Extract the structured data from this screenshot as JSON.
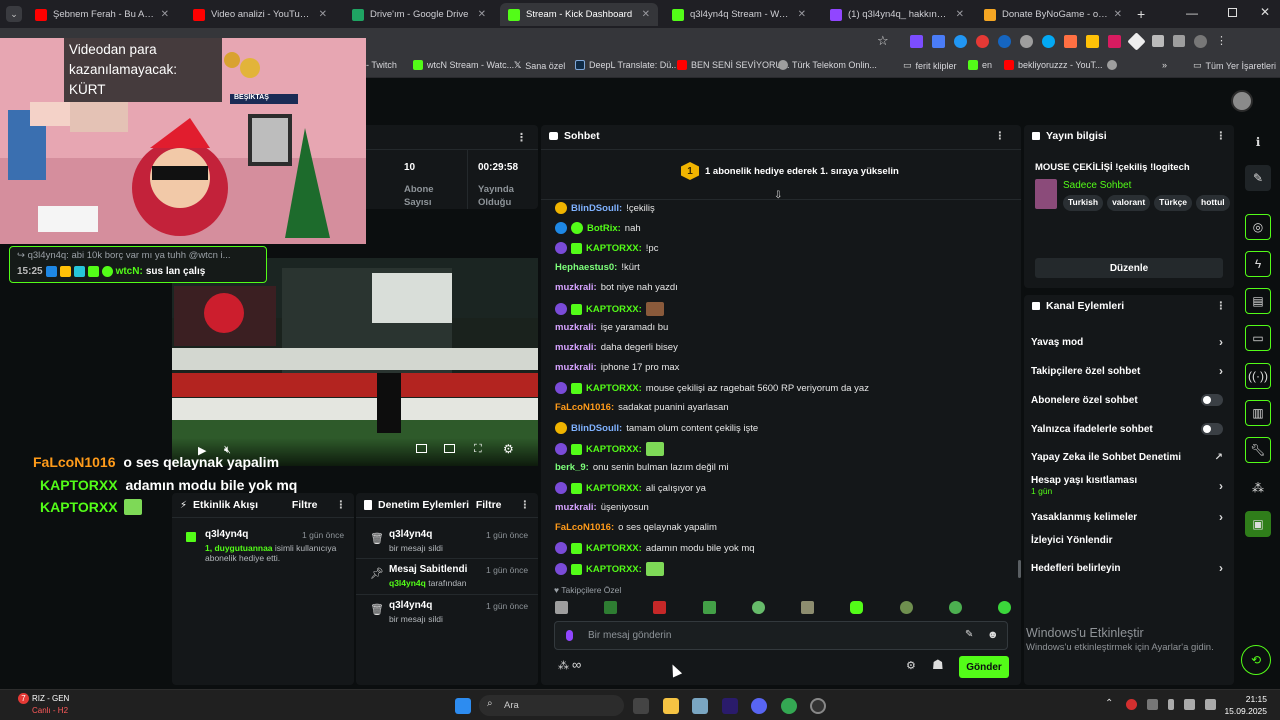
{
  "browser": {
    "tabs": [
      {
        "label": "Şebnem Ferah - Bu Aşk Fazla Sı",
        "color": "#ff0000"
      },
      {
        "label": "Video analizi - YouTube Studio",
        "color": "#ff0000"
      },
      {
        "label": "Drive'ım - Google Drive",
        "color": "#1fa463"
      },
      {
        "label": "Stream - Kick Dashboard",
        "color": "#53fc18"
      },
      {
        "label": "q3l4yn4q Stream - Watch Live o",
        "color": "#53fc18"
      },
      {
        "label": "(1) q3l4yn4q_ hakkında - Twitch",
        "color": "#9146ff"
      },
      {
        "label": "Donate ByNoGame - oyundiyc",
        "color": "#f5a623"
      }
    ],
    "bookmarks": [
      "- Twitch",
      "wtcN Stream - Watc...",
      "Sana özel",
      "DeepL Translate: Dü...",
      "BEN SENİ SEVİYORU...",
      "Türk Telekom Onlin...",
      "ferit klipler",
      "en",
      "bekliyoruzzz - YouT...",
      "Tüm Yer İşaretleri"
    ]
  },
  "overlay": {
    "warning_text": "Videodan para kazanılamayacak: KÜRT",
    "banner_text": "BEŞİKTAŞ",
    "pin_reply": "q3l4yn4q: abi 10k borç var mı ya tuhh @wtcn i...",
    "pin_time": "15:25",
    "pin_user": "wtcN:",
    "pin_text": "sus lan çalış",
    "bigchat": [
      {
        "user": "FaLcoN1016",
        "text": "o ses qelaynak yapalim",
        "color": "#ff9b1a"
      },
      {
        "user": "KAPTORXX",
        "text": "adamın modu bile yok mq",
        "color": "#53fc18"
      },
      {
        "user": "KAPTORXX",
        "text": "",
        "color": "#53fc18"
      }
    ]
  },
  "stats": {
    "count_value": "10",
    "count_label": "Abone Sayısı",
    "time_value": "00:29:58",
    "time_label": "Yayında Olduğu"
  },
  "activity": {
    "title": "Etkinlik Akışı",
    "filter": "Filtre",
    "item_user": "q3l4yn4q",
    "item_time": "1 gün önce",
    "item_highlight": "1, duygutuannaa",
    "item_text": "isimli kullanıcıya abonelik hediye etti."
  },
  "moderation": {
    "title": "Denetim Eylemleri",
    "filter": "Filtre",
    "items": [
      {
        "title": "q3l4yn4q",
        "sub": "bir mesajı sildi",
        "time": "1 gün önce",
        "hl": ""
      },
      {
        "title": "Mesaj Sabitlendi",
        "sub": "tarafından",
        "time": "1 gün önce",
        "hl": "q3l4yn4q"
      },
      {
        "title": "q3l4yn4q",
        "sub": "bir mesajı sildi",
        "time": "1 gün önce",
        "hl": ""
      }
    ]
  },
  "chat": {
    "title": "Sohbet",
    "promo": "1 abonelik hediye ederek 1. sıraya yükselin",
    "promo_number": "1",
    "messages": [
      {
        "user": "BlinDSoull:",
        "text": "!çekiliş",
        "color": "#7fb2ff",
        "badge": "#f0b400"
      },
      {
        "user": "BotRix:",
        "text": "nah",
        "color": "#53fc18",
        "badge": "#1e88e5"
      },
      {
        "user": "KAPTORXX:",
        "text": "!pc",
        "color": "#53fc18",
        "badge": "#7a4bd8"
      },
      {
        "user": "Hephaestus0:",
        "text": "!kürt",
        "color": "#7dff7a",
        "badge": ""
      },
      {
        "user": "muzkrali:",
        "text": "bot niye nah yazdı",
        "color": "#d6a3ff",
        "badge": ""
      },
      {
        "user": "KAPTORXX:",
        "text": "",
        "color": "#53fc18",
        "badge": "#7a4bd8"
      },
      {
        "user": "muzkrali:",
        "text": "işe yaramadı bu",
        "color": "#d6a3ff",
        "badge": ""
      },
      {
        "user": "muzkrali:",
        "text": "daha degerli bisey",
        "color": "#d6a3ff",
        "badge": ""
      },
      {
        "user": "muzkrali:",
        "text": "iphone 17 pro max",
        "color": "#d6a3ff",
        "badge": ""
      },
      {
        "user": "KAPTORXX:",
        "text": "mouse çekilişi az ragebait 5600 RP veriyorum da yaz",
        "color": "#53fc18",
        "badge": "#7a4bd8"
      },
      {
        "user": "FaLcoN1016:",
        "text": "sadakat puanini ayarlasan",
        "color": "#ff9b1a",
        "badge": ""
      },
      {
        "user": "BlinDSoull:",
        "text": "tamam olum content çekiliş işte",
        "color": "#7fb2ff",
        "badge": "#f0b400"
      },
      {
        "user": "KAPTORXX:",
        "text": "",
        "color": "#53fc18",
        "badge": "#7a4bd8"
      },
      {
        "user": "berk_9:",
        "text": "onu senin bulman lazım değil mi",
        "color": "#7dff7a",
        "badge": ""
      },
      {
        "user": "KAPTORXX:",
        "text": "ali çalışıyor ya",
        "color": "#53fc18",
        "badge": "#7a4bd8"
      },
      {
        "user": "muzkrali:",
        "text": "üşeniyosun",
        "color": "#d6a3ff",
        "badge": ""
      },
      {
        "user": "FaLcoN1016:",
        "text": "o ses qelaynak yapalim",
        "color": "#ff9b1a",
        "badge": ""
      },
      {
        "user": "KAPTORXX:",
        "text": "adamın modu bile yok mq",
        "color": "#53fc18",
        "badge": "#7a4bd8"
      },
      {
        "user": "KAPTORXX:",
        "text": "",
        "color": "#53fc18",
        "badge": "#7a4bd8"
      }
    ],
    "followers_only": "Takipçilere Özel",
    "input_placeholder": "Bir mesaj gönderin",
    "send_label": "Gönder"
  },
  "stream_info": {
    "title": "Yayın bilgisi",
    "stream_title": "MOUSE ÇEKİLİŞİ !çekiliş !logitech",
    "category": "Sadece Sohbet",
    "tags": [
      "Turkish",
      "valorant",
      "Türkçe",
      "hottul"
    ],
    "edit_label": "Düzenle"
  },
  "channel_actions": {
    "title": "Kanal Eylemleri",
    "rows": [
      {
        "label": "Yavaş mod",
        "kind": "chev",
        "sub": ""
      },
      {
        "label": "Takipçilere özel sohbet",
        "kind": "chev",
        "sub": ""
      },
      {
        "label": "Abonelere özel sohbet",
        "kind": "toggle",
        "sub": ""
      },
      {
        "label": "Yalnızca ifadelerle sohbet",
        "kind": "toggle",
        "sub": ""
      },
      {
        "label": "Yapay Zeka ile Sohbet Denetimi",
        "kind": "ext",
        "sub": ""
      },
      {
        "label": "Hesap yaşı kısıtlaması",
        "kind": "chev",
        "sub": "1 gün"
      },
      {
        "label": "Yasaklanmış kelimeler",
        "kind": "chev",
        "sub": ""
      },
      {
        "label": "İzleyici Yönlendir",
        "kind": "none",
        "sub": ""
      },
      {
        "label": "Hedefleri belirleyin",
        "kind": "chev",
        "sub": ""
      }
    ]
  },
  "windows": {
    "activate_title": "Windows'u Etkinleştir",
    "activate_sub": "Windows'u etkinleştirmek için Ayarlar'a gidin.",
    "weather_temp": "7",
    "weather_city": "RIZ - GEN",
    "weather_status": "Canlı - H2",
    "search": "Ara",
    "time": "21:15",
    "date": "15.09.2025"
  },
  "colors": {
    "kick_green": "#53fc18",
    "panel": "#141719",
    "bg": "#0b0e0f"
  }
}
